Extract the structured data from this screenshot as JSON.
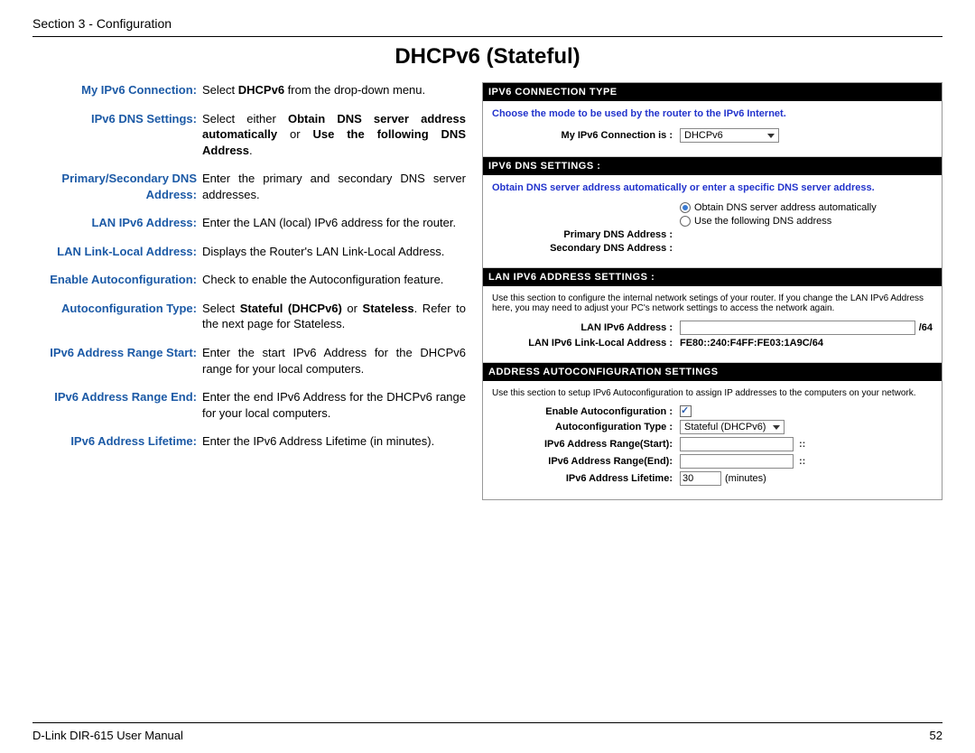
{
  "header": {
    "section": "Section 3 - Configuration"
  },
  "title": "DHCPv6 (Stateful)",
  "definitions": [
    {
      "term": "My IPv6 Connection:",
      "desc_html": "Select <b>DHCPv6</b> from the drop-down menu."
    },
    {
      "term": "IPv6 DNS Settings:",
      "desc_html": "Select either <b>Obtain DNS server address automatically</b> or <b>Use the following DNS Address</b>."
    },
    {
      "term": "Primary/Secondary DNS Address:",
      "desc_html": "Enter the primary and secondary DNS server addresses."
    },
    {
      "term": "LAN IPv6 Address:",
      "desc_html": "Enter the LAN (local) IPv6 address for the router."
    },
    {
      "term": "LAN Link-Local Address:",
      "desc_html": "Displays the Router's LAN Link-Local Address."
    },
    {
      "term": "Enable Autoconfiguration:",
      "desc_html": "Check to enable the Autoconfiguration feature."
    },
    {
      "term": "Autoconfiguration Type:",
      "desc_html": "Select <b>Stateful (DHCPv6)</b> or <b>Stateless</b>. Refer to the next page for Stateless."
    },
    {
      "term": "IPv6 Address Range Start:",
      "desc_html": "Enter the start IPv6 Address for the DHCPv6 range for your local computers."
    },
    {
      "term": "IPv6 Address Range End:",
      "desc_html": "Enter the end IPv6 Address for the DHCPv6 range for your local computers."
    },
    {
      "term": "IPv6 Address Lifetime:",
      "desc_html": "Enter the IPv6 Address Lifetime (in minutes)."
    }
  ],
  "panel": {
    "conn_type": {
      "header": "IPV6 CONNECTION TYPE",
      "note": "Choose the mode to be used by the router to the IPv6 Internet.",
      "label": "My IPv6 Connection is :",
      "value": "DHCPv6"
    },
    "dns": {
      "header": "IPV6 DNS SETTINGS :",
      "note": "Obtain DNS server address automatically or enter a specific DNS server address.",
      "radio_auto": "Obtain DNS server address automatically",
      "radio_manual": "Use the following DNS address",
      "primary_label": "Primary DNS Address :",
      "secondary_label": "Secondary DNS Address :"
    },
    "lan": {
      "header": "LAN IPV6 ADDRESS SETTINGS :",
      "note": "Use this section to configure the internal network setings of your router. If you change the LAN IPv6 Address here, you may need to adjust your PC's network settings to access the network again.",
      "addr_label": "LAN IPv6 Address :",
      "addr_suffix": "/64",
      "linklocal_label": "LAN IPv6 Link-Local Address :",
      "linklocal_value": "FE80::240:F4FF:FE03:1A9C/64"
    },
    "auto": {
      "header": "ADDRESS AUTOCONFIGURATION SETTINGS",
      "note": "Use this section to setup IPv6 Autoconfiguration to assign IP addresses to the computers on your network.",
      "enable_label": "Enable Autoconfiguration :",
      "type_label": "Autoconfiguration Type :",
      "type_value": "Stateful (DHCPv6)",
      "range_start_label": "IPv6 Address Range(Start):",
      "range_end_label": "IPv6 Address Range(End):",
      "lifetime_label": "IPv6 Address Lifetime:",
      "lifetime_value": "30",
      "lifetime_unit": "(minutes)"
    }
  },
  "footer": {
    "left": "D-Link DIR-615 User Manual",
    "right": "52"
  }
}
